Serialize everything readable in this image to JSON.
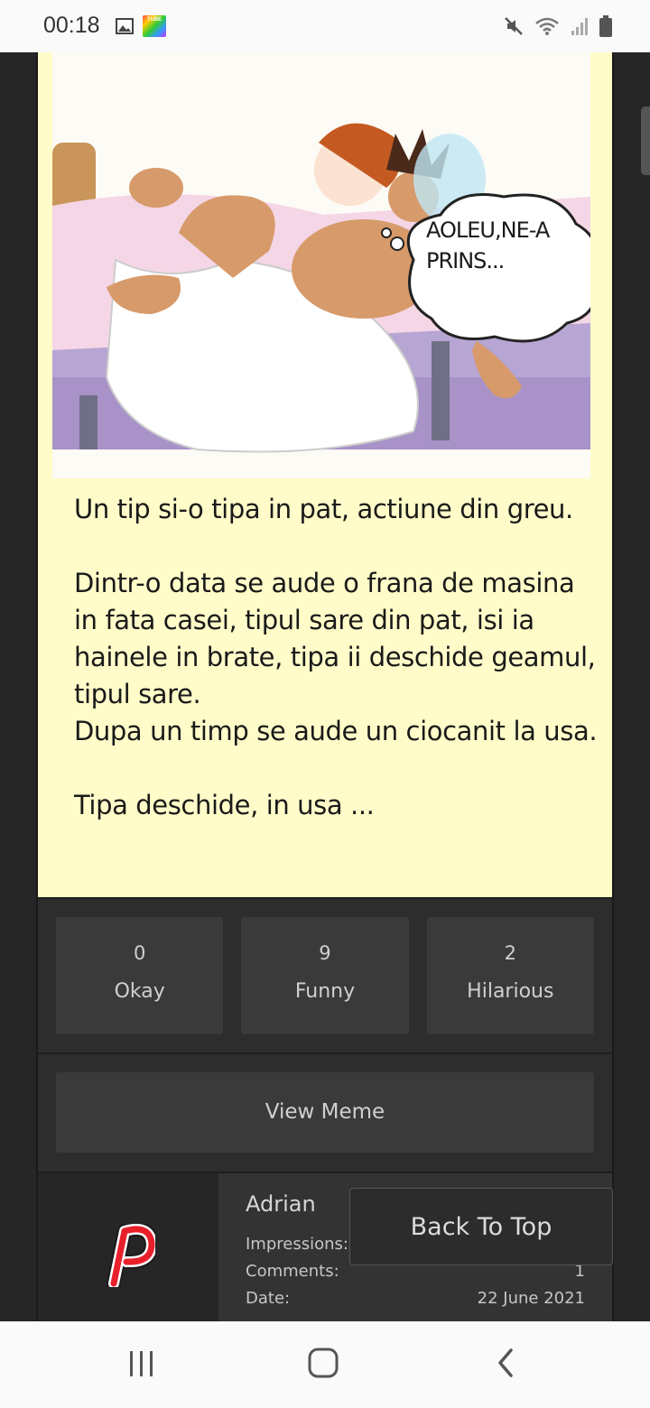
{
  "status_bar": {
    "time": "00:18",
    "app_badge": "TUBE",
    "icons": [
      "image-icon",
      "app-tube-icon",
      "mute-icon",
      "wifi-icon",
      "signal-icon",
      "battery-icon"
    ]
  },
  "meme": {
    "speech_bubble": "AOLEU,NE-A\nPRINS...",
    "joke_text": "Un tip si-o tipa in pat, actiune din greu.\n\nDintr-o data se aude o frana de masina in fata casei, tipul sare din pat, isi ia hainele in brate, tipa ii deschide geamul, tipul sare.\nDupa un timp se aude un ciocanit la usa.\n\nTipa deschide, in usa ..."
  },
  "reactions": [
    {
      "count": "0",
      "label": "Okay"
    },
    {
      "count": "9",
      "label": "Funny"
    },
    {
      "count": "2",
      "label": "Hilarious"
    }
  ],
  "view_meme_label": "View Meme",
  "author": {
    "name": "Adrian",
    "impressions_label": "Impressions:",
    "impressions_value": "",
    "comments_label": "Comments:",
    "comments_value": "1",
    "date_label": "Date:",
    "date_value": "22 June 2021"
  },
  "back_to_top_label": "Back To Top",
  "colors": {
    "meme_background": "#fffcc9",
    "page_background": "#262626",
    "button_background": "#3a3a3a",
    "avatar_red": "#e8202a"
  }
}
